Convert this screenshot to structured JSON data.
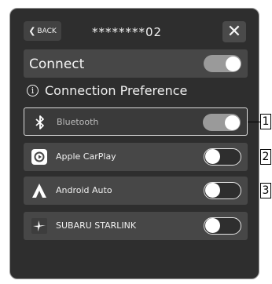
{
  "header": {
    "back_label": "BACK",
    "device_name": "********02",
    "close_glyph": "✕"
  },
  "connect": {
    "label": "Connect",
    "enabled": true
  },
  "section": {
    "info_glyph": "i",
    "title": "Connection Preference"
  },
  "options": [
    {
      "label": "Bluetooth",
      "icon": "bluetooth-icon",
      "enabled": true,
      "selected": true
    },
    {
      "label": "Apple CarPlay",
      "icon": "apple-carplay-icon",
      "enabled": false,
      "selected": false
    },
    {
      "label": "Android Auto",
      "icon": "android-auto-icon",
      "enabled": false,
      "selected": false
    },
    {
      "label": "SUBARU STARLINK",
      "icon": "subaru-starlink-icon",
      "enabled": false,
      "selected": false
    }
  ],
  "callouts": [
    "1",
    "2",
    "3"
  ],
  "colors": {
    "panel": "#2e2e2e",
    "row": "#474747",
    "toggle_on": "#9a9a9a"
  }
}
